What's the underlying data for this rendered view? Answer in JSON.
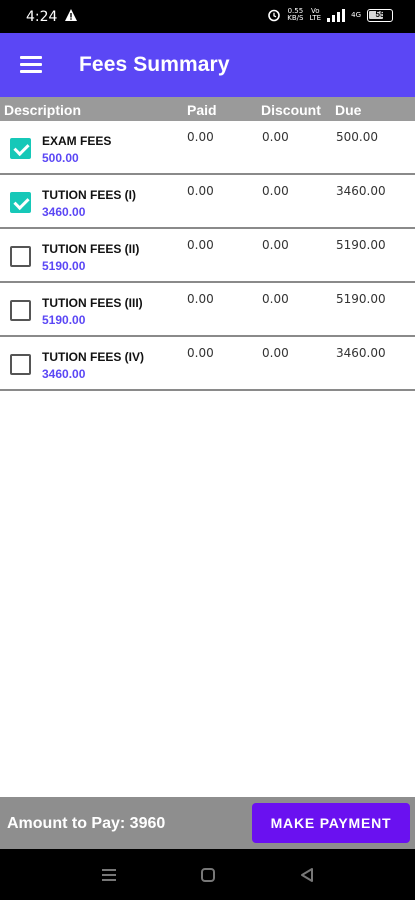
{
  "status_bar": {
    "time": "4:24",
    "net_speed_top": "0.55",
    "net_speed_bottom": "KB/S",
    "net_type": "4G",
    "battery": "55"
  },
  "app_bar": {
    "title": "Fees Summary"
  },
  "table": {
    "headers": {
      "description": "Description",
      "paid": "Paid",
      "discount": "Discount",
      "due": "Due"
    },
    "rows": [
      {
        "name": "EXAM FEES",
        "amount": "500.00",
        "paid": "0.00",
        "discount": "0.00",
        "due": "500.00",
        "checked": true
      },
      {
        "name": "TUTION FEES (I)",
        "amount": "3460.00",
        "paid": "0.00",
        "discount": "0.00",
        "due": "3460.00",
        "checked": true
      },
      {
        "name": "TUTION FEES (II)",
        "amount": "5190.00",
        "paid": "0.00",
        "discount": "0.00",
        "due": "5190.00",
        "checked": false
      },
      {
        "name": "TUTION FEES (III)",
        "amount": "5190.00",
        "paid": "0.00",
        "discount": "0.00",
        "due": "5190.00",
        "checked": false
      },
      {
        "name": "TUTION FEES (IV)",
        "amount": "3460.00",
        "paid": "0.00",
        "discount": "0.00",
        "due": "3460.00",
        "checked": false
      }
    ]
  },
  "footer": {
    "amount_to_pay": "Amount to Pay: 3960",
    "make_payment_label": "MAKE PAYMENT"
  },
  "icons": {
    "menu": "hamburger-menu-icon",
    "warning": "warning-triangle-icon",
    "alarm": "alarm-clock-icon",
    "signal": "signal-bars-icon",
    "battery": "battery-icon",
    "nav_recents": "recents-menu-icon",
    "nav_home": "home-square-icon",
    "nav_back": "back-triangle-icon"
  },
  "colors": {
    "app_bar": "#5b47f5",
    "table_header": "#9a9a9a",
    "checkbox_checked": "#16c8b8",
    "amount_text": "#5b47f5",
    "footer": "#8e8e8e",
    "pay_button": "#6a11f0"
  }
}
